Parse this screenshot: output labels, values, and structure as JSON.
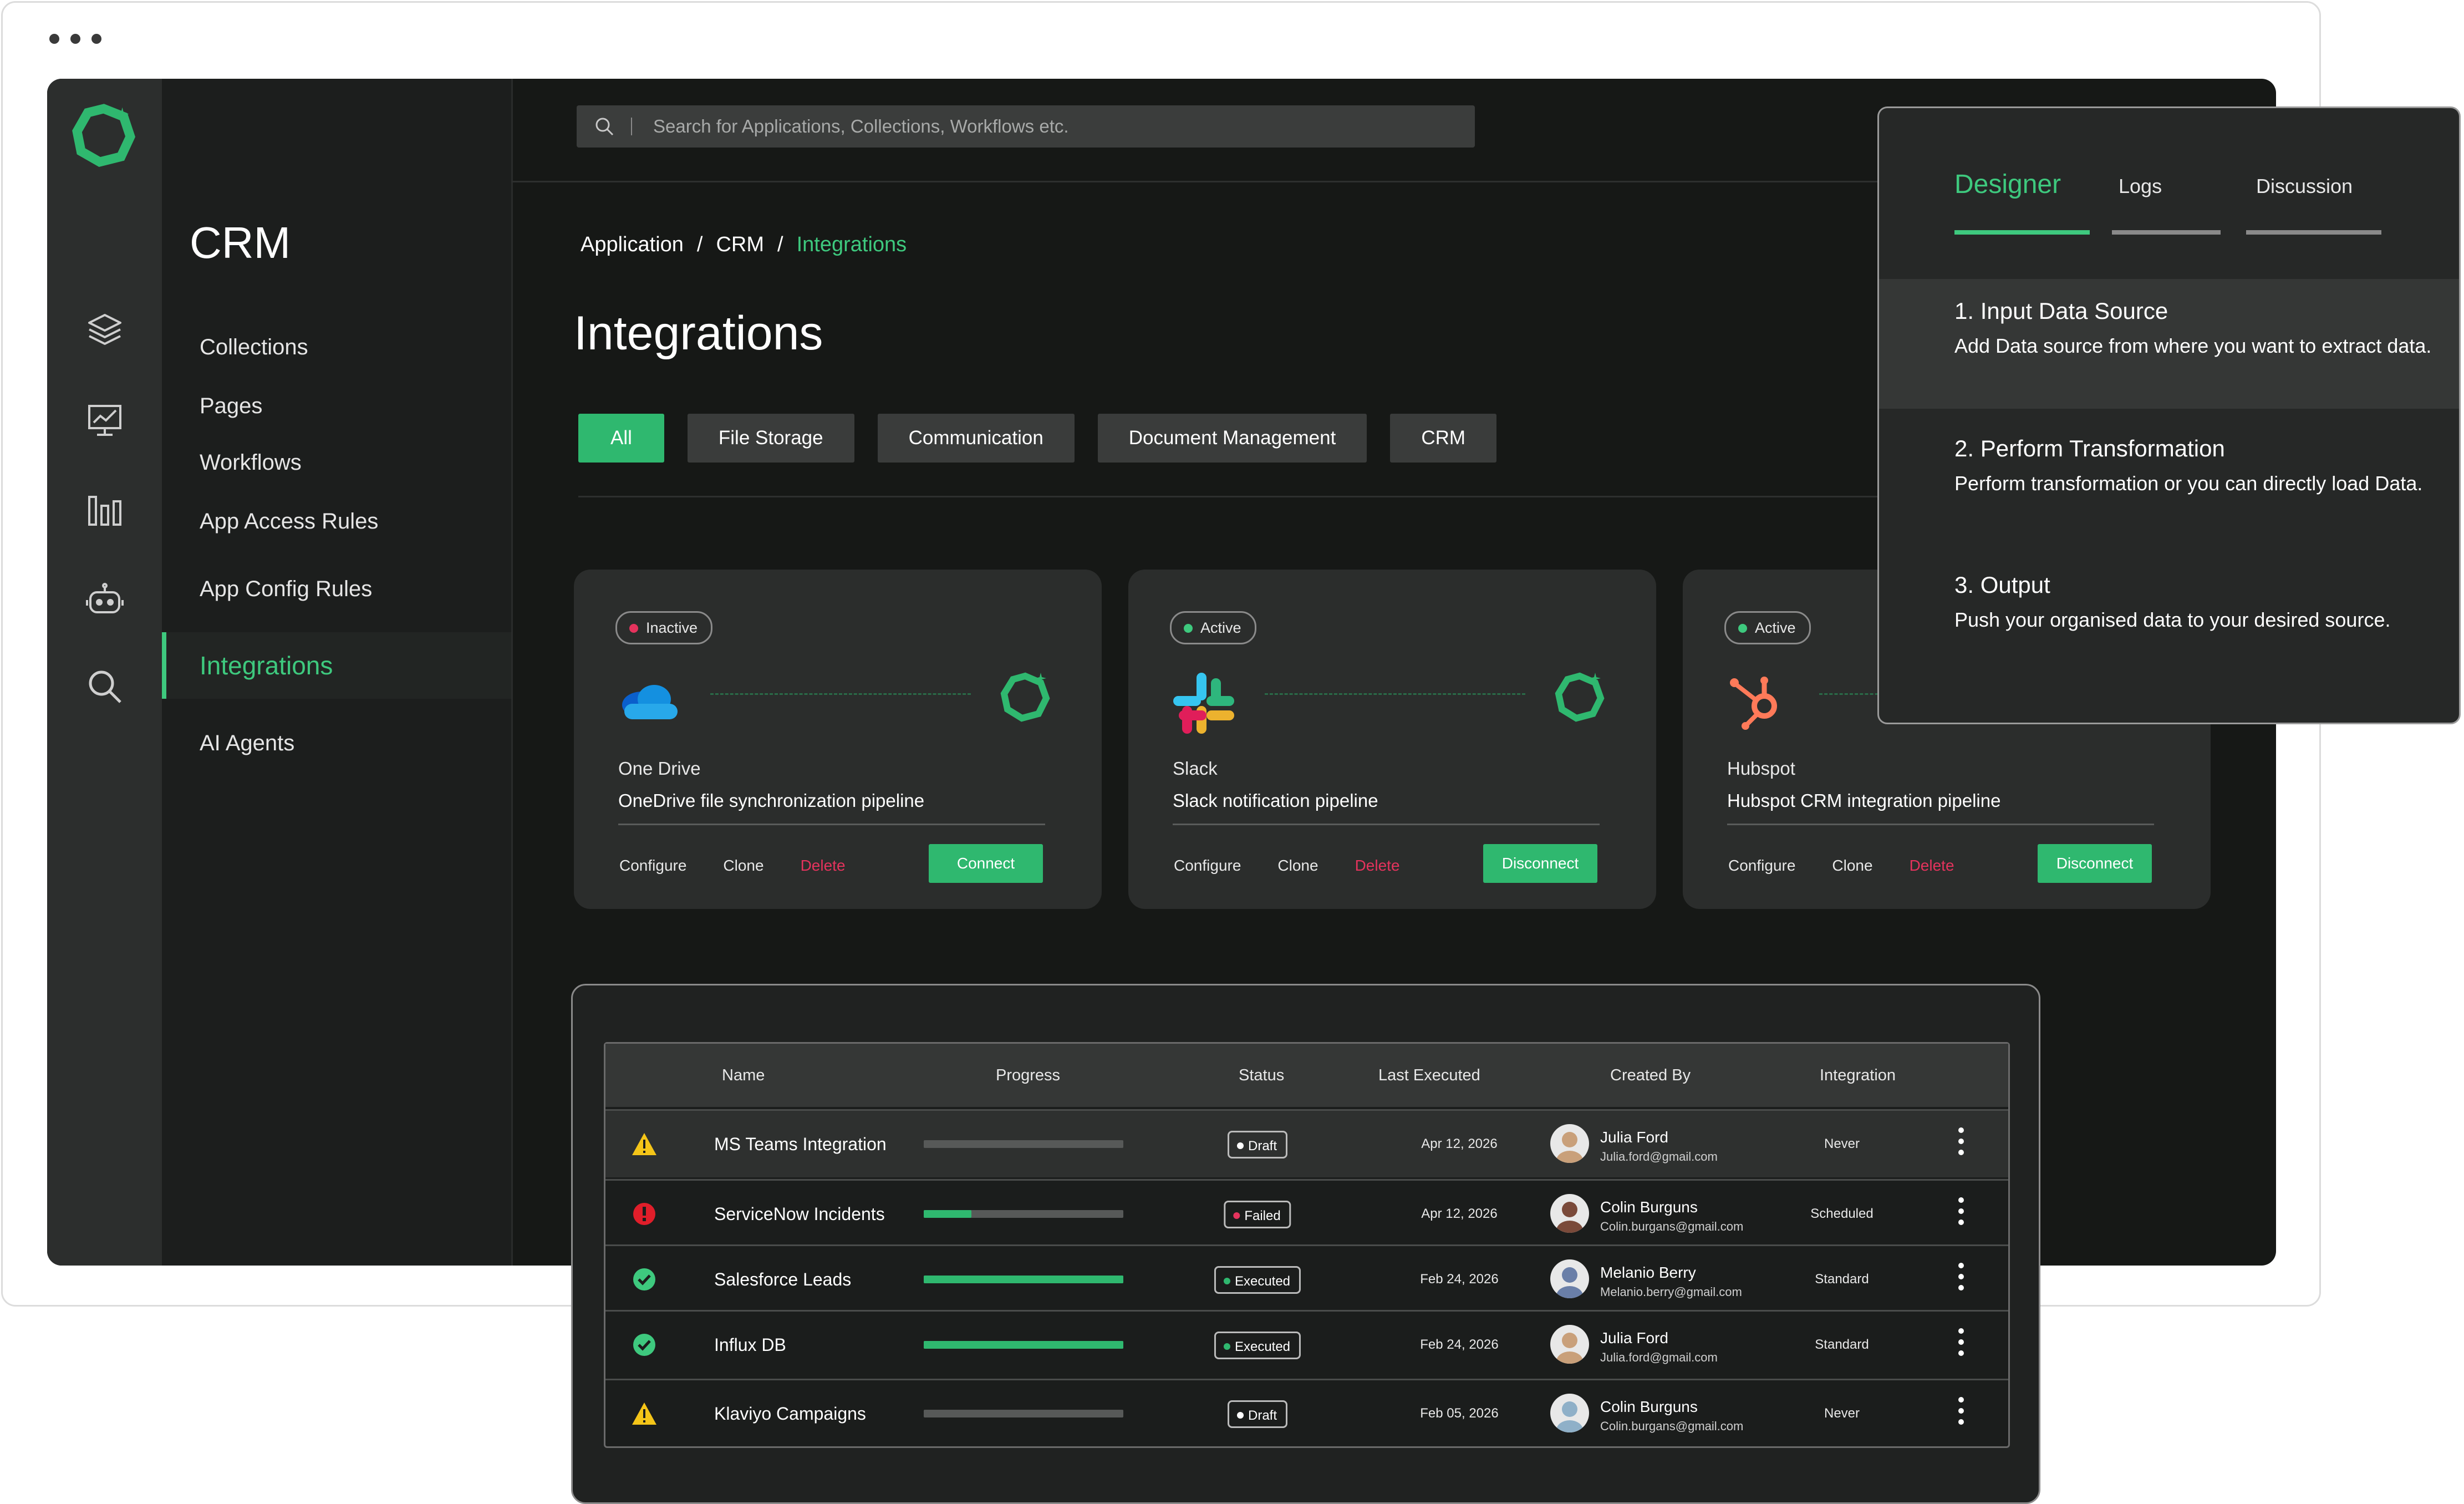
{
  "sidebar": {
    "title": "CRM",
    "items": [
      {
        "label": "Collections"
      },
      {
        "label": "Pages"
      },
      {
        "label": "Workflows"
      },
      {
        "label": "App Access Rules"
      },
      {
        "label": "App Config Rules"
      },
      {
        "label": "Integrations",
        "active": true
      },
      {
        "label": "AI Agents"
      }
    ],
    "rail_icons": [
      "layers-icon",
      "dashboard-icon",
      "bar-chart-icon",
      "robot-icon",
      "search-icon"
    ]
  },
  "search": {
    "placeholder": "Search for Applications, Collections, Workflows etc."
  },
  "breadcrumb": {
    "items": [
      "Application",
      "CRM",
      "Integrations"
    ],
    "separator": "/"
  },
  "page": {
    "title": "Integrations"
  },
  "filters": [
    "All",
    "File Storage",
    "Communication",
    "Document Management",
    "CRM"
  ],
  "cards": [
    {
      "status": "Inactive",
      "status_color": "#e5335d",
      "name": "One Drive",
      "description": "OneDrive file synchronization pipeline",
      "actions": [
        "Configure",
        "Clone",
        "Delete"
      ],
      "button": "Connect",
      "icon": "onedrive-icon"
    },
    {
      "status": "Active",
      "status_color": "#3ec97e",
      "name": "Slack",
      "description": "Slack notification pipeline",
      "actions": [
        "Configure",
        "Clone",
        "Delete"
      ],
      "button": "Disconnect",
      "icon": "slack-icon"
    },
    {
      "status": "Active",
      "status_color": "#3ec97e",
      "name": "Hubspot",
      "description": "Hubspot CRM integration pipeline",
      "actions": [
        "Configure",
        "Clone",
        "Delete"
      ],
      "button": "Disconnect",
      "icon": "hubspot-icon"
    }
  ],
  "designer": {
    "tabs": [
      "Designer",
      "Logs",
      "Discussion"
    ],
    "active_tab": "Designer",
    "steps": [
      {
        "title": "1.  Input Data Source",
        "description": "Add Data source from where you want to extract data."
      },
      {
        "title": "2.  Perform Transformation",
        "description": "Perform transformation or you can directly load Data."
      },
      {
        "title": "3.  Output",
        "description": "Push your organised data to your desired source."
      }
    ]
  },
  "table": {
    "columns": [
      "Name",
      "Progress",
      "Status",
      "Last Executed",
      "Created By",
      "Integration"
    ],
    "rows": [
      {
        "icon": "warning-icon",
        "name": "MS Teams Integration",
        "progress": 0.0,
        "status": "Draft",
        "status_color": "#ffffff",
        "last_executed": "Apr 12, 2026",
        "user": "Julia Ford",
        "email": "Julia.ford@gmail.com",
        "integration": "Never"
      },
      {
        "icon": "error-icon",
        "name": "ServiceNow Incidents",
        "progress": 0.24,
        "status": "Failed",
        "status_color": "#e5335d",
        "last_executed": "Apr 12, 2026",
        "user": "Colin Burguns",
        "email": "Colin.burgans@gmail.com",
        "integration": "Scheduled"
      },
      {
        "icon": "success-icon",
        "name": "Salesforce Leads",
        "progress": 1.0,
        "status": "Executed",
        "status_color": "#2fb86f",
        "last_executed": "Feb 24, 2026",
        "user": "Melanio Berry",
        "email": "Melanio.berry@gmail.com",
        "integration": "Standard"
      },
      {
        "icon": "success-icon",
        "name": "Influx DB",
        "progress": 1.0,
        "status": "Executed",
        "status_color": "#2fb86f",
        "last_executed": "Feb 24, 2026",
        "user": "Julia Ford",
        "email": "Julia.ford@gmail.com",
        "integration": "Standard"
      },
      {
        "icon": "warning-icon",
        "name": "Klaviyo Campaigns",
        "progress": 0.0,
        "status": "Draft",
        "status_color": "#ffffff",
        "last_executed": "Feb 05, 2026",
        "user": "Colin Burguns",
        "email": "Colin.burgans@gmail.com",
        "integration": "Never"
      }
    ]
  },
  "colors": {
    "accent": "#3ec97e",
    "button": "#2fb86f",
    "danger": "#e5335d",
    "background": "#161816"
  }
}
